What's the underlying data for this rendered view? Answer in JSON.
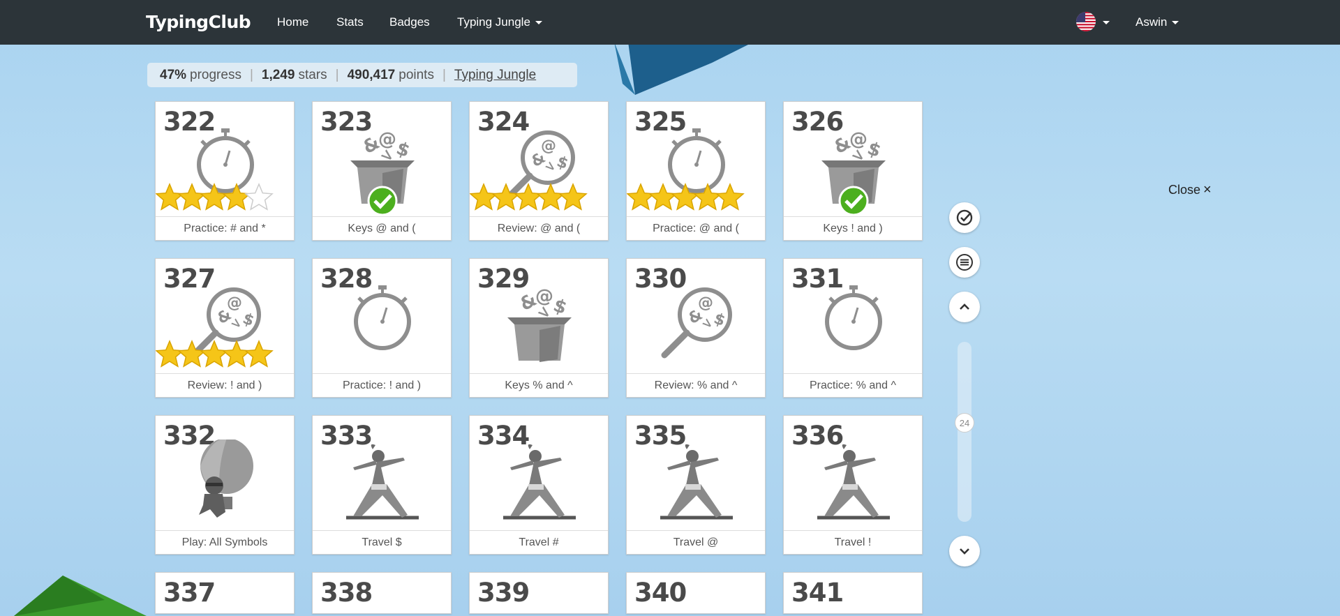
{
  "navbar": {
    "brand": "TypingClub",
    "links": [
      "Home",
      "Stats",
      "Badges",
      "Typing Jungle"
    ],
    "user": "Aswin",
    "language_icon": "us-flag-icon"
  },
  "progress": {
    "percent": "47%",
    "percent_label": "progress",
    "stars": "1,249",
    "stars_label": "stars",
    "points": "490,417",
    "points_label": "points",
    "link": "Typing Jungle"
  },
  "lessons": [
    {
      "num": "322",
      "label": "Practice: # and *",
      "icon": "stopwatch",
      "stars": 4,
      "badge": "none"
    },
    {
      "num": "323",
      "label": "Keys @ and (",
      "icon": "box",
      "stars": 0,
      "badge": "check"
    },
    {
      "num": "324",
      "label": "Review: @ and (",
      "icon": "magnifier",
      "stars": 5,
      "badge": "none"
    },
    {
      "num": "325",
      "label": "Practice: @ and (",
      "icon": "stopwatch",
      "stars": 5,
      "badge": "none"
    },
    {
      "num": "326",
      "label": "Keys ! and )",
      "icon": "box",
      "stars": 0,
      "badge": "check"
    },
    {
      "num": "327",
      "label": "Review: ! and )",
      "icon": "magnifier",
      "stars": 5,
      "badge": "none"
    },
    {
      "num": "328",
      "label": "Practice: ! and )",
      "icon": "stopwatch",
      "stars": 0,
      "badge": "none"
    },
    {
      "num": "329",
      "label": "Keys % and ^",
      "icon": "box",
      "stars": 0,
      "badge": "none"
    },
    {
      "num": "330",
      "label": "Review: % and ^",
      "icon": "magnifier",
      "stars": 0,
      "badge": "none"
    },
    {
      "num": "331",
      "label": "Practice: % and ^",
      "icon": "stopwatch",
      "stars": 0,
      "badge": "none"
    },
    {
      "num": "332",
      "label": "Play: All Symbols",
      "icon": "balloon",
      "stars": 0,
      "badge": "none"
    },
    {
      "num": "333",
      "label": "Travel $",
      "icon": "yoga",
      "stars": 0,
      "badge": "none"
    },
    {
      "num": "334",
      "label": "Travel #",
      "icon": "yoga",
      "stars": 0,
      "badge": "none"
    },
    {
      "num": "335",
      "label": "Travel @",
      "icon": "yoga",
      "stars": 0,
      "badge": "none"
    },
    {
      "num": "336",
      "label": "Travel !",
      "icon": "yoga",
      "stars": 0,
      "badge": "none"
    },
    {
      "num": "337",
      "label": "",
      "icon": "",
      "stars": 0,
      "badge": "none"
    },
    {
      "num": "338",
      "label": "",
      "icon": "",
      "stars": 0,
      "badge": "none"
    },
    {
      "num": "339",
      "label": "",
      "icon": "",
      "stars": 0,
      "badge": "none"
    },
    {
      "num": "340",
      "label": "",
      "icon": "",
      "stars": 0,
      "badge": "none"
    },
    {
      "num": "341",
      "label": "",
      "icon": "",
      "stars": 0,
      "badge": "none"
    }
  ],
  "side_nav": {
    "scroll_position": "24",
    "close_label": "Close",
    "close_icon": "close-icon",
    "buttons": [
      "check-circle-icon",
      "list-icon",
      "chevron-up-icon",
      "chevron-down-icon"
    ]
  },
  "colors": {
    "navbar": "#2c3439",
    "star": "#f5c518",
    "check": "#4caf1e",
    "icon_gray": "#8e8e8e"
  }
}
